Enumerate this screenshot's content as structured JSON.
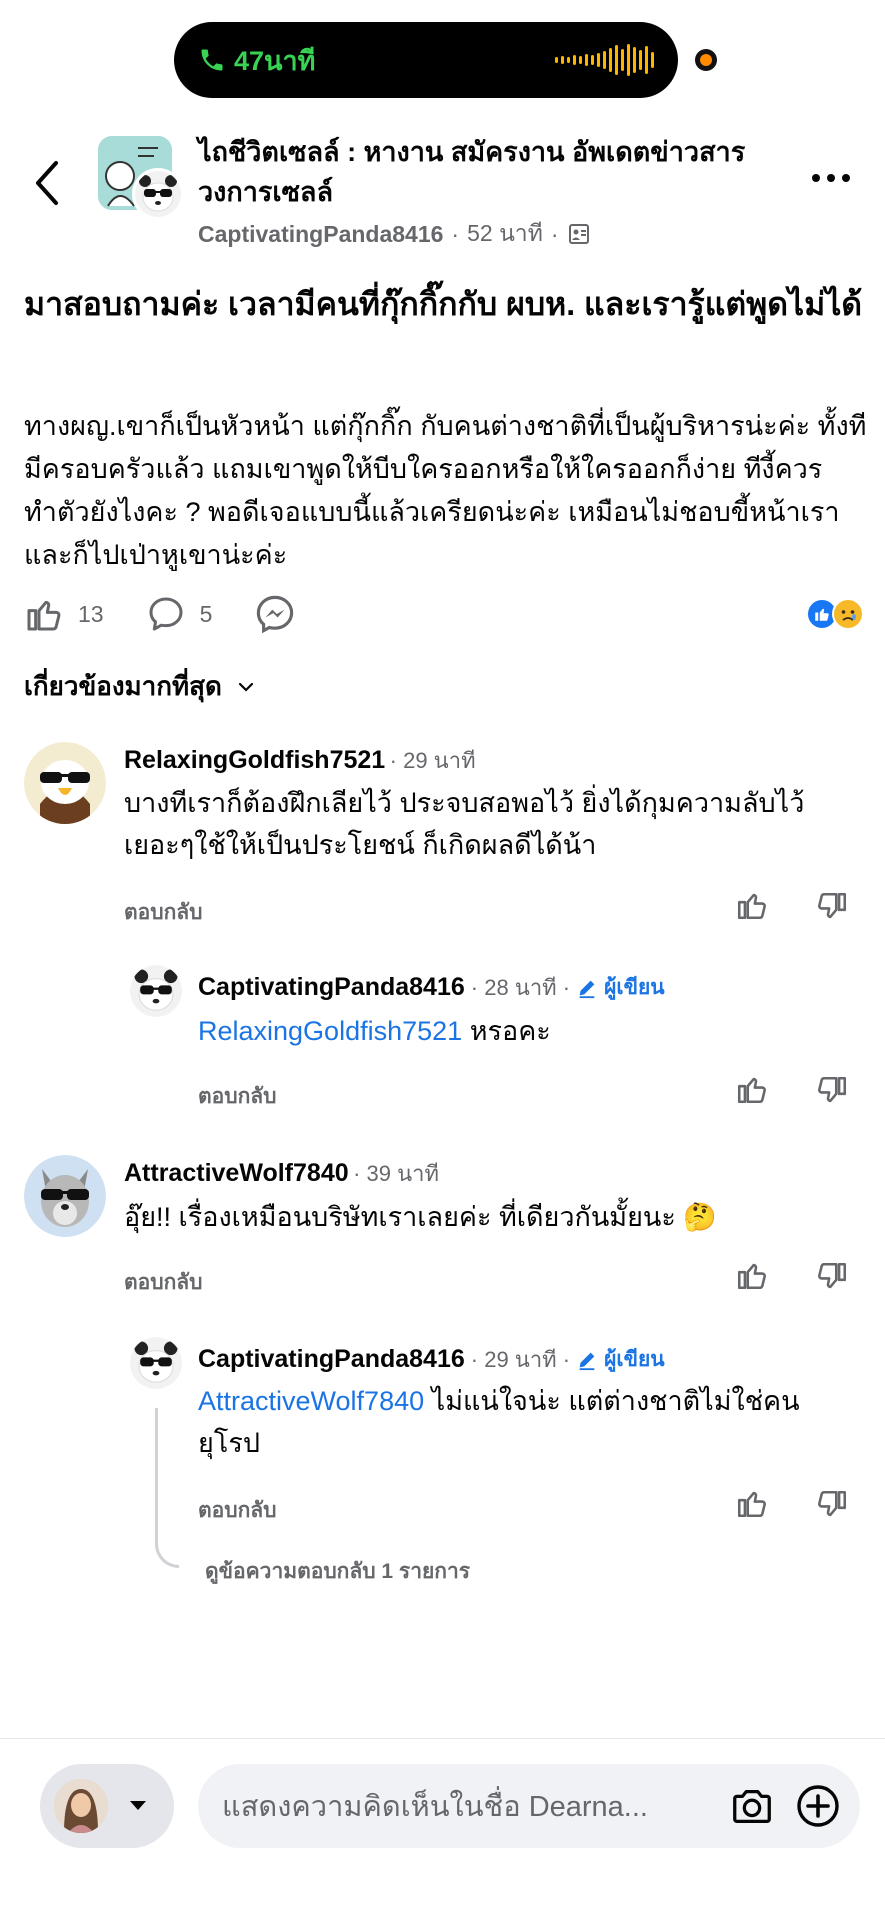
{
  "status_bar": {
    "call_duration": "47นาที"
  },
  "header": {
    "group_name": "ไถชีวิตเซลล์ : หางาน สมัครงาน อัพเดตข่าวสารวงการเซลล์",
    "author": "CaptivatingPanda8416",
    "time": "52 นาที",
    "separator": "·"
  },
  "post": {
    "title": "มาสอบถามค่ะ เวลามีคนที่กุ๊กกิ๊กกับ ผบห. และเรารู้แต่พูดไม่ได้",
    "body": "ทางผญ.เขาก็เป็นหัวหน้า แต่กุ๊กกิ๊ก กับคนต่างชาติที่เป็นผู้บริหารน่ะค่ะ ทั้งทีมีครอบครัวแล้ว แถมเขาพูดให้บีบใครออกหรือให้ใครออกก็ง่าย ทีงี้ควรทำตัวยังไงคะ ? พอดีเจอแบบนี้แล้วเครียดน่ะค่ะ เหมือนไม่ชอบขี้หน้าเราและก็ไปเป่าหูเขาน่ะค่ะ",
    "likes": "13",
    "comments": "5"
  },
  "sort": {
    "label": "เกี่ยวข้องมากที่สุด"
  },
  "comments": [
    {
      "name": "RelaxingGoldfish7521",
      "time": "· 29 นาที",
      "text": "บางทีเราก็ต้องฝึกเลียไว้ ประจบสอพอไว้  ยิ่งได้กุมความลับไว้เยอะๆใช้ให้เป็นประโยชน์ ก็เกิดผลดีได้น้า",
      "reply_label": "ตอบกลับ",
      "replies": [
        {
          "name": "CaptivatingPanda8416",
          "time": "· 28 นาที ·",
          "badge": "ผู้เขียน",
          "mention": "RelaxingGoldfish7521",
          "text": " หรอคะ",
          "reply_label": "ตอบกลับ"
        }
      ]
    },
    {
      "name": "AttractiveWolf7840",
      "time": "· 39 นาที",
      "text": "อุ๊ย!! เรื่องเหมือนบริษัทเราเลยค่ะ ที่เดียวกันมั้ยนะ 🤔",
      "reply_label": "ตอบกลับ",
      "replies": [
        {
          "name": "CaptivatingPanda8416",
          "time": "· 29 นาที ·",
          "badge": "ผู้เขียน",
          "mention": "AttractiveWolf7840",
          "text": " ไม่แน่ใจน่ะ แต่ต่างชาติไม่ใช่คนยุโรป",
          "reply_label": "ตอบกลับ"
        }
      ],
      "view_more_replies": "ดูข้อความตอบกลับ 1 รายการ"
    }
  ],
  "composer": {
    "placeholder": "แสดงความคิดเห็นในชื่อ Dearna..."
  },
  "colors": {
    "accent": "#1b74e4",
    "call_green": "#39d353",
    "wave_yellow": "#ffb400",
    "secondary_text": "#65676b"
  }
}
